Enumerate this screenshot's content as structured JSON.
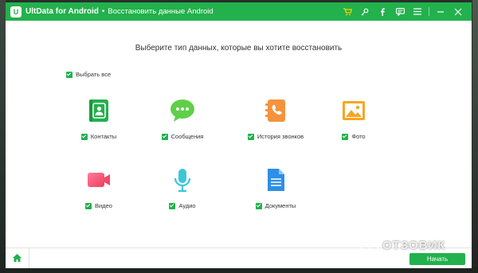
{
  "titlebar": {
    "logo_letter": "U",
    "app_name": "UltData for Android",
    "separator": "•",
    "subtitle": "Восстановить данные Android",
    "icons": [
      "cart-icon",
      "key-icon",
      "facebook-icon",
      "feedback-icon",
      "menu-icon",
      "minimize-icon",
      "close-icon"
    ]
  },
  "main": {
    "heading": "Выберите тип данных, которые вы хотите восстановить",
    "select_all_label": "Выбрать все",
    "items": [
      {
        "label": "Контакты",
        "icon": "contacts-icon",
        "color": "#22b14c",
        "checked": true
      },
      {
        "label": "Сообщения",
        "icon": "messages-icon",
        "color": "#5fcf4a",
        "checked": true
      },
      {
        "label": "История звонков",
        "icon": "call-history-icon",
        "color": "#f5923e",
        "checked": true
      },
      {
        "label": "Фото",
        "icon": "photo-icon",
        "color": "#f6a623",
        "checked": true
      },
      {
        "label": "Видео",
        "icon": "video-icon",
        "color": "#f2506b",
        "checked": true
      },
      {
        "label": "Аудио",
        "icon": "audio-icon",
        "color": "#3cc6d8",
        "checked": true
      },
      {
        "label": "Документы",
        "icon": "documents-icon",
        "color": "#2e8fe6",
        "checked": true
      }
    ]
  },
  "footer": {
    "start_label": "Начать"
  },
  "watermark": {
    "text": "ОТЗОВИК"
  },
  "colors": {
    "accent": "#22b14c"
  }
}
